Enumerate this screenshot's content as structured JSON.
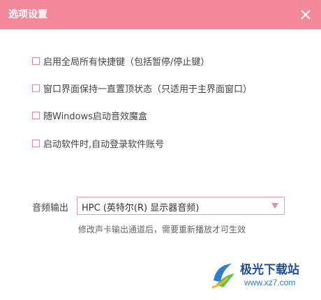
{
  "window": {
    "title": "选项设置",
    "accent_color": "#f4899c"
  },
  "options": [
    {
      "label": "启用全局所有快捷键（包括暂停/停止键）",
      "checked": false
    },
    {
      "label": "窗口界面保持一直置顶状态（只适用于主界面窗口）",
      "checked": false
    },
    {
      "label": "随Windows启动音效魔盒",
      "checked": false
    },
    {
      "label": "启动软件时,自动登录软件账号",
      "checked": false
    }
  ],
  "audio_output": {
    "label": "音频输出",
    "selected": "HPC (英特尔(R) 显示器音频)",
    "hint": "修改声卡输出通道后，需要重新播放才可生效"
  },
  "watermark": {
    "name": "极光下载站",
    "url": "www.xz7.com"
  }
}
